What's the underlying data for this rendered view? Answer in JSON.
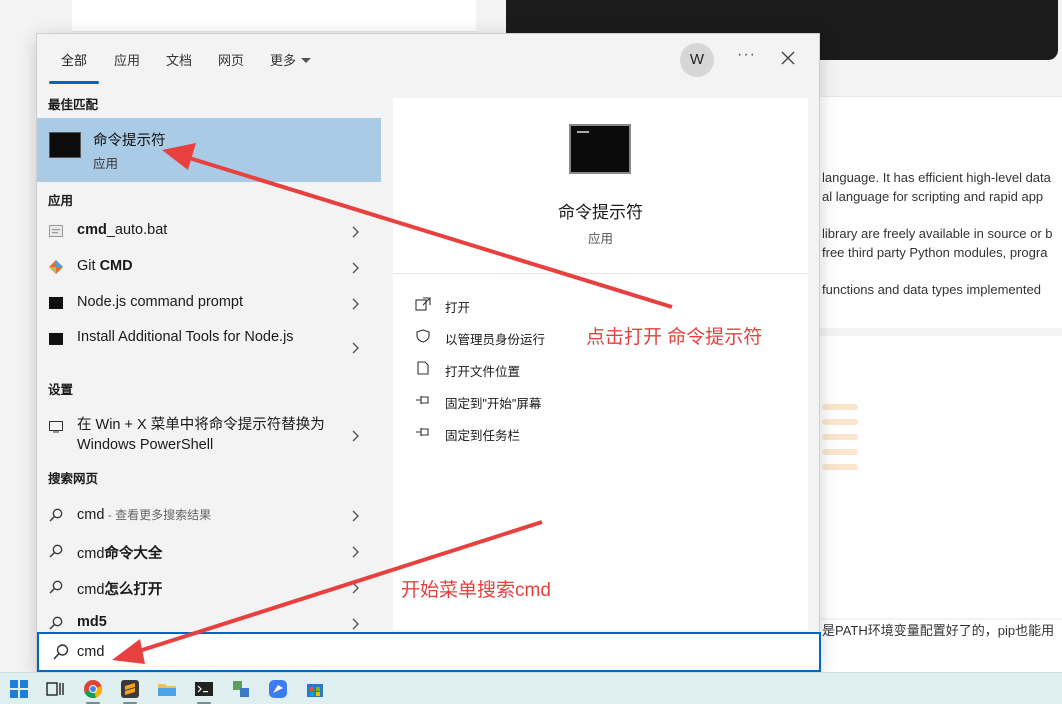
{
  "background": {
    "text_lines": [
      "language. It has efficient high-level data",
      "al language for scripting and rapid app",
      "library are freely available in source or b",
      " free third party Python modules, progra",
      "functions and data types implemented",
      "是PATH环境变量配置好了的，pip也能用"
    ]
  },
  "start_menu": {
    "tabs": [
      "全部",
      "应用",
      "文档",
      "网页",
      "更多"
    ],
    "avatar_letter": "W",
    "more_label": "···",
    "sections": {
      "best_match": "最佳匹配",
      "apps": "应用",
      "settings": "设置",
      "web": "搜索网页"
    },
    "best_match": {
      "title": "命令提示符",
      "subtitle": "应用"
    },
    "apps": [
      {
        "bold": "cmd",
        "rest": "_auto.bat",
        "icon": "batch-file-icon"
      },
      {
        "bold": "CMD",
        "prefix": "Git ",
        "icon": "git-icon"
      },
      {
        "text": "Node.js command prompt",
        "icon": "terminal-icon"
      },
      {
        "text": "Install Additional Tools for Node.js",
        "icon": "terminal-icon"
      }
    ],
    "settings": [
      {
        "text": "在 Win + X 菜单中将命令提示符替换为 Windows PowerShell",
        "icon": "display-icon"
      }
    ],
    "web": [
      {
        "main": "cmd",
        "suffix": " - 查看更多搜索结果"
      },
      {
        "main": "cmd",
        "bold": "命令大全"
      },
      {
        "main": "cmd",
        "bold": "怎么打开"
      },
      {
        "main": "",
        "bold": "md5"
      }
    ],
    "detail": {
      "title": "命令提示符",
      "subtitle": "应用",
      "actions": [
        "打开",
        "以管理员身份运行",
        "打开文件位置",
        "固定到\"开始\"屏幕",
        "固定到任务栏"
      ]
    },
    "search_value": "cmd"
  },
  "annotations": {
    "open_note": "点击打开 命令提示符",
    "search_note": "开始菜单搜索cmd",
    "color": "#e8403e"
  }
}
